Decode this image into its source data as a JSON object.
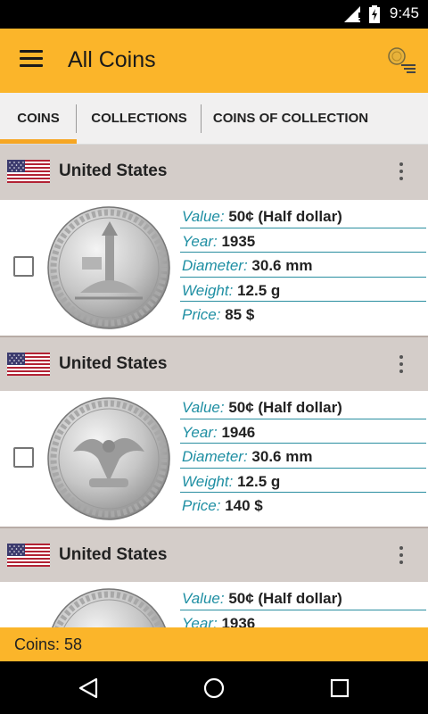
{
  "status_bar": {
    "time": "9:45"
  },
  "app_bar": {
    "title": "All Coins"
  },
  "tabs": [
    {
      "label": "COINS"
    },
    {
      "label": "COLLECTIONS"
    },
    {
      "label": "COINS OF COLLECTION"
    }
  ],
  "labels": {
    "value": "Value:",
    "year": "Year:",
    "diameter": "Diameter:",
    "weight": "Weight:",
    "price": "Price:"
  },
  "items": [
    {
      "country": "United States",
      "value": "50¢ (Half dollar)",
      "year": "1935",
      "diameter": "30.6 mm",
      "weight": "12.5 g",
      "price": "85 $"
    },
    {
      "country": "United States",
      "value": "50¢ (Half dollar)",
      "year": "1946",
      "diameter": "30.6 mm",
      "weight": "12.5 g",
      "price": "140 $"
    },
    {
      "country": "United States",
      "value": "50¢ (Half dollar)",
      "year": "1936",
      "diameter": "",
      "weight": "",
      "price": ""
    }
  ],
  "footer": {
    "count": "Coins: 58"
  },
  "colors": {
    "accent": "#fbb52a",
    "label": "#1f8fa3",
    "header": "#d4cdc9"
  }
}
